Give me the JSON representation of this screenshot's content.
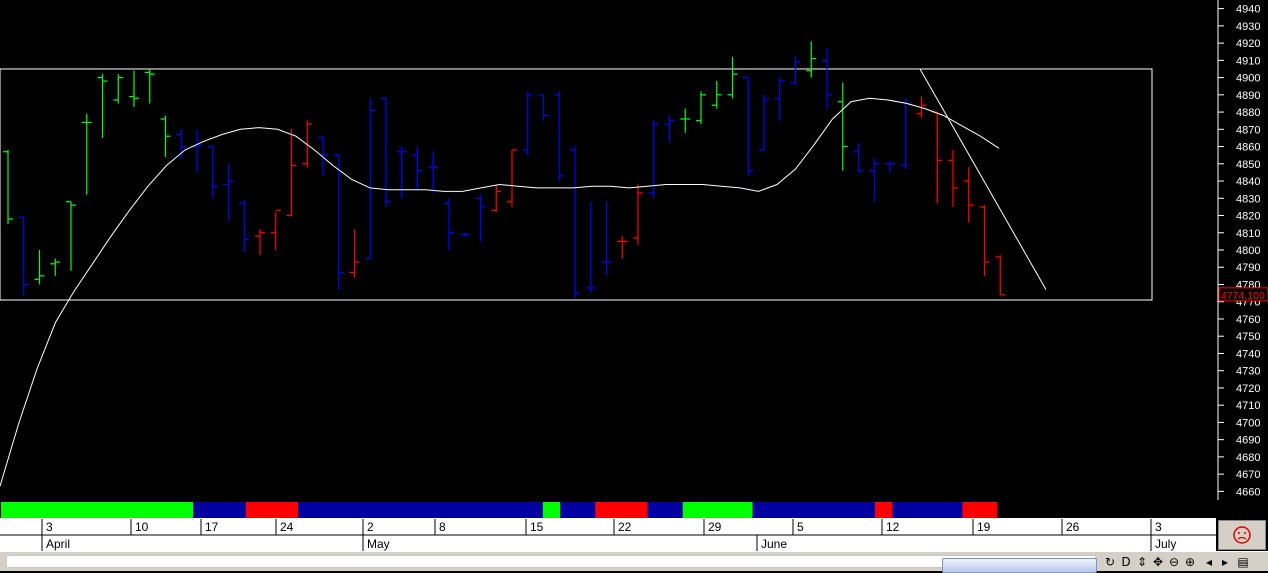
{
  "chart_data": {
    "type": "ohlc",
    "ylim": [
      4655,
      4945
    ],
    "y_ticks": [
      4660,
      4670,
      4680,
      4690,
      4700,
      4710,
      4720,
      4730,
      4740,
      4750,
      4760,
      4770,
      4780,
      4790,
      4800,
      4810,
      4820,
      4830,
      4840,
      4850,
      4860,
      4870,
      4880,
      4890,
      4900,
      4910,
      4920,
      4930,
      4940
    ],
    "last_price_label": "4774.100",
    "colors": {
      "up": "#00ff00",
      "neutral": "#0000ff",
      "down": "#ff0000",
      "line": "#ffffff",
      "last_price": "#ff0000"
    },
    "bars": [
      {
        "high": 4858,
        "low": 4815,
        "open": 4857,
        "close": 4818,
        "color": "green"
      },
      {
        "high": 4819,
        "low": 4773,
        "open": 4819,
        "close": 4780,
        "color": "blue"
      },
      {
        "high": 4800,
        "low": 4780,
        "open": 4783,
        "close": 4785,
        "color": "green"
      },
      {
        "high": 4795,
        "low": 4785,
        "open": 4792,
        "close": 4793,
        "color": "green"
      },
      {
        "high": 4828,
        "low": 4788,
        "open": 4828,
        "close": 4826,
        "color": "green"
      },
      {
        "high": 4879,
        "low": 4832,
        "open": 4874,
        "close": 4874,
        "color": "green"
      },
      {
        "high": 4902,
        "low": 4865,
        "open": 4900,
        "close": 4898,
        "color": "green"
      },
      {
        "high": 4902,
        "low": 4885,
        "open": 4887,
        "close": 4900,
        "color": "green"
      },
      {
        "high": 4904,
        "low": 4883,
        "open": 4889,
        "close": 4888,
        "color": "green"
      },
      {
        "high": 4905,
        "low": 4885,
        "open": 4903,
        "close": 4902,
        "color": "green"
      },
      {
        "high": 4878,
        "low": 4854,
        "open": 4876,
        "close": 4866,
        "color": "green"
      },
      {
        "high": 4870,
        "low": 4853,
        "open": 4867,
        "close": 4860,
        "color": "blue"
      },
      {
        "high": 4870,
        "low": 4845,
        "open": 4860,
        "close": 4861,
        "color": "blue"
      },
      {
        "high": 4860,
        "low": 4830,
        "open": 4860,
        "close": 4837,
        "color": "blue"
      },
      {
        "high": 4850,
        "low": 4817,
        "open": 4838,
        "close": 4840,
        "color": "blue"
      },
      {
        "high": 4829,
        "low": 4799,
        "open": 4827,
        "close": 4806,
        "color": "blue"
      },
      {
        "high": 4812,
        "low": 4797,
        "open": 4808,
        "close": 4810,
        "color": "red"
      },
      {
        "high": 4822,
        "low": 4800,
        "open": 4810,
        "close": 4823,
        "color": "red"
      },
      {
        "high": 4870,
        "low": 4820,
        "open": 4820,
        "close": 4849,
        "color": "red"
      },
      {
        "high": 4875,
        "low": 4848,
        "open": 4850,
        "close": 4873,
        "color": "red"
      },
      {
        "high": 4866,
        "low": 4843,
        "open": 4865,
        "close": 4855,
        "color": "blue"
      },
      {
        "high": 4855,
        "low": 4777,
        "open": 4855,
        "close": 4787,
        "color": "blue"
      },
      {
        "high": 4812,
        "low": 4784,
        "open": 4787,
        "close": 4793,
        "color": "red"
      },
      {
        "high": 4888,
        "low": 4795,
        "open": 4795,
        "close": 4881,
        "color": "blue"
      },
      {
        "high": 4888,
        "low": 4825,
        "open": 4888,
        "close": 4828,
        "color": "blue"
      },
      {
        "high": 4860,
        "low": 4830,
        "open": 4857,
        "close": 4857,
        "color": "blue"
      },
      {
        "high": 4860,
        "low": 4835,
        "open": 4855,
        "close": 4846,
        "color": "blue"
      },
      {
        "high": 4857,
        "low": 4833,
        "open": 4848,
        "close": 4848,
        "color": "blue"
      },
      {
        "high": 4830,
        "low": 4800,
        "open": 4827,
        "close": 4810,
        "color": "blue"
      },
      {
        "high": 4810,
        "low": 4808,
        "open": 4809,
        "close": 4809,
        "color": "blue"
      },
      {
        "high": 4832,
        "low": 4805,
        "open": 4830,
        "close": 4825,
        "color": "blue"
      },
      {
        "high": 4838,
        "low": 4822,
        "open": 4823,
        "close": 4834,
        "color": "red"
      },
      {
        "high": 4858,
        "low": 4825,
        "open": 4828,
        "close": 4858,
        "color": "red"
      },
      {
        "high": 4892,
        "low": 4855,
        "open": 4858,
        "close": 4890,
        "color": "blue"
      },
      {
        "high": 4890,
        "low": 4875,
        "open": 4890,
        "close": 4878,
        "color": "blue"
      },
      {
        "high": 4892,
        "low": 4840,
        "open": 4890,
        "close": 4843,
        "color": "blue"
      },
      {
        "high": 4860,
        "low": 4772,
        "open": 4858,
        "close": 4775,
        "color": "blue"
      },
      {
        "high": 4828,
        "low": 4775,
        "open": 4778,
        "close": 4778,
        "color": "blue"
      },
      {
        "high": 4828,
        "low": 4785,
        "open": 4793,
        "close": 4793,
        "color": "blue"
      },
      {
        "high": 4808,
        "low": 4795,
        "open": 4805,
        "close": 4805,
        "color": "red"
      },
      {
        "high": 4838,
        "low": 4803,
        "open": 4807,
        "close": 4833,
        "color": "red"
      },
      {
        "high": 4875,
        "low": 4830,
        "open": 4833,
        "close": 4873,
        "color": "blue"
      },
      {
        "high": 4878,
        "low": 4863,
        "open": 4873,
        "close": 4875,
        "color": "blue"
      },
      {
        "high": 4882,
        "low": 4868,
        "open": 4876,
        "close": 4876,
        "color": "green"
      },
      {
        "high": 4892,
        "low": 4873,
        "open": 4875,
        "close": 4890,
        "color": "green"
      },
      {
        "high": 4898,
        "low": 4882,
        "open": 4884,
        "close": 4890,
        "color": "green"
      },
      {
        "high": 4912,
        "low": 4888,
        "open": 4890,
        "close": 4902,
        "color": "green"
      },
      {
        "high": 4900,
        "low": 4843,
        "open": 4900,
        "close": 4846,
        "color": "blue"
      },
      {
        "high": 4890,
        "low": 4858,
        "open": 4858,
        "close": 4887,
        "color": "blue"
      },
      {
        "high": 4900,
        "low": 4875,
        "open": 4888,
        "close": 4898,
        "color": "blue"
      },
      {
        "high": 4912,
        "low": 4896,
        "open": 4897,
        "close": 4909,
        "color": "blue"
      },
      {
        "high": 4921,
        "low": 4900,
        "open": 4904,
        "close": 4911,
        "color": "green"
      },
      {
        "high": 4917,
        "low": 4882,
        "open": 4910,
        "close": 4890,
        "color": "blue"
      },
      {
        "high": 4897,
        "low": 4846,
        "open": 4886,
        "close": 4860,
        "color": "green"
      },
      {
        "high": 4862,
        "low": 4845,
        "open": 4857,
        "close": 4846,
        "color": "blue"
      },
      {
        "high": 4853,
        "low": 4828,
        "open": 4846,
        "close": 4850,
        "color": "blue"
      },
      {
        "high": 4851,
        "low": 4845,
        "open": 4850,
        "close": 4850,
        "color": "blue"
      },
      {
        "high": 4888,
        "low": 4847,
        "open": 4849,
        "close": 4885,
        "color": "blue"
      },
      {
        "high": 4889,
        "low": 4877,
        "open": 4879,
        "close": 4884,
        "color": "red"
      },
      {
        "high": 4880,
        "low": 4827,
        "open": 4880,
        "close": 4852,
        "color": "red"
      },
      {
        "high": 4858,
        "low": 4825,
        "open": 4852,
        "close": 4836,
        "color": "red"
      },
      {
        "high": 4848,
        "low": 4816,
        "open": 4840,
        "close": 4826,
        "color": "red"
      },
      {
        "high": 4826,
        "low": 4785,
        "open": 4825,
        "close": 4793,
        "color": "red"
      },
      {
        "high": 4797,
        "low": 4774,
        "open": 4796,
        "close": 4774,
        "color": "red"
      }
    ],
    "moving_average": [
      4663,
      4699,
      4731,
      4758,
      4776,
      4792,
      4808,
      4823,
      4837,
      4849,
      4858,
      4863,
      4867,
      4870,
      4871,
      4870,
      4866,
      4858,
      4849,
      4841,
      4836,
      4835,
      4835,
      4835,
      4834,
      4834,
      4836,
      4838,
      4837,
      4836,
      4836,
      4836,
      4837,
      4837,
      4836,
      4837,
      4838,
      4838,
      4838,
      4837,
      4836,
      4834,
      4838,
      4847,
      4861,
      4876,
      4886,
      4888,
      4887,
      4885,
      4882,
      4878,
      4872,
      4866,
      4859
    ],
    "rectangle": {
      "y_top": 4905,
      "y_bottom": 4771
    },
    "trendline": {
      "from": 4905,
      "to": 4777
    },
    "signal_band": [
      {
        "color": "green",
        "from": 0,
        "to": 11
      },
      {
        "color": "blue",
        "from": 11,
        "to": 14
      },
      {
        "color": "red",
        "from": 14,
        "to": 17
      },
      {
        "color": "blue",
        "from": 17,
        "to": 31
      },
      {
        "color": "green",
        "from": 31,
        "to": 32
      },
      {
        "color": "blue",
        "from": 32,
        "to": 34
      },
      {
        "color": "red",
        "from": 34,
        "to": 37
      },
      {
        "color": "blue",
        "from": 37,
        "to": 39
      },
      {
        "color": "green",
        "from": 39,
        "to": 43
      },
      {
        "color": "blue",
        "from": 43,
        "to": 50
      },
      {
        "color": "red",
        "from": 50,
        "to": 51
      },
      {
        "color": "blue",
        "from": 51,
        "to": 55
      },
      {
        "color": "red",
        "from": 55,
        "to": 57
      }
    ],
    "x_day_labels": [
      "3",
      "10",
      "17",
      "24",
      "2",
      "8",
      "15",
      "22",
      "29",
      "5",
      "12",
      "19",
      "26",
      "3"
    ],
    "x_month_labels": [
      "April",
      "May",
      "June",
      "July"
    ]
  },
  "statusbar": {
    "icons": [
      "refresh-icon",
      "cursor-icon",
      "pan-icon",
      "zoom-out-icon",
      "zoom-in-icon",
      "scroll-left-icon",
      "scroll-right-icon",
      "window-icon"
    ]
  }
}
